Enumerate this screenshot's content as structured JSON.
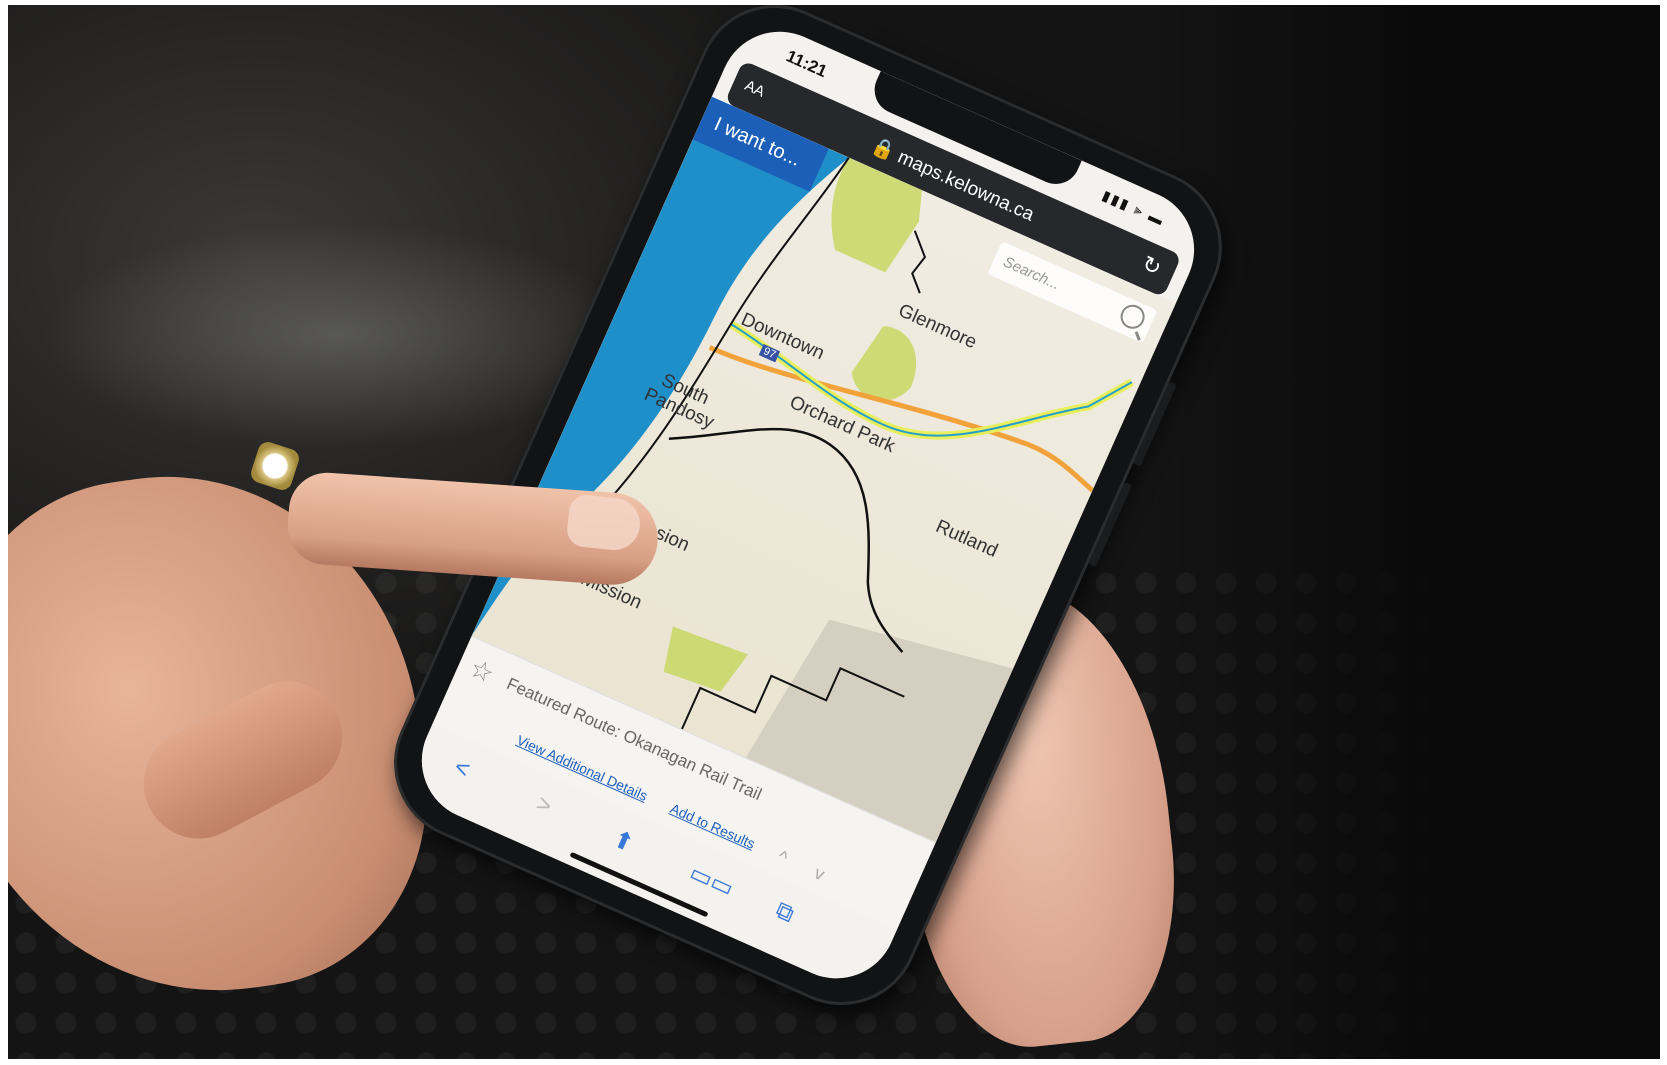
{
  "phone": {
    "status_time": "11:21",
    "status_icons": "▮▮▮ ⫸ ▬"
  },
  "browser": {
    "text_size": "AA",
    "url": "🔒 maps.kelowna.ca",
    "reload": "↻"
  },
  "map": {
    "menu_button": "I want to...",
    "search_placeholder": "Search...",
    "places": {
      "glenmore": "Glenmore",
      "downtown": "Downtown",
      "orchard_park": "Orchard Park",
      "rutland": "Rutland",
      "south": "South",
      "pandosy": "Pandosy",
      "lower_mission": "Lower Mission",
      "upper_mission": "Upper Mission",
      "highway": "97"
    }
  },
  "route": {
    "featured": "Featured Route: Okanagan Rail Trail",
    "view_details": "View Additional Details",
    "add_results": "Add to Results",
    "up": "^",
    "down": "v"
  },
  "toolbar": {
    "back": "<",
    "forward": ">",
    "share": "⬆",
    "bookmarks": "▭▭",
    "tabs": "⧉"
  },
  "colors": {
    "lake": "#1e8fc9",
    "park": "#c5d65a",
    "rail_trail": "#e9ef5c",
    "highway": "#f2a23a",
    "menu_blue": "#1b5fb8"
  }
}
